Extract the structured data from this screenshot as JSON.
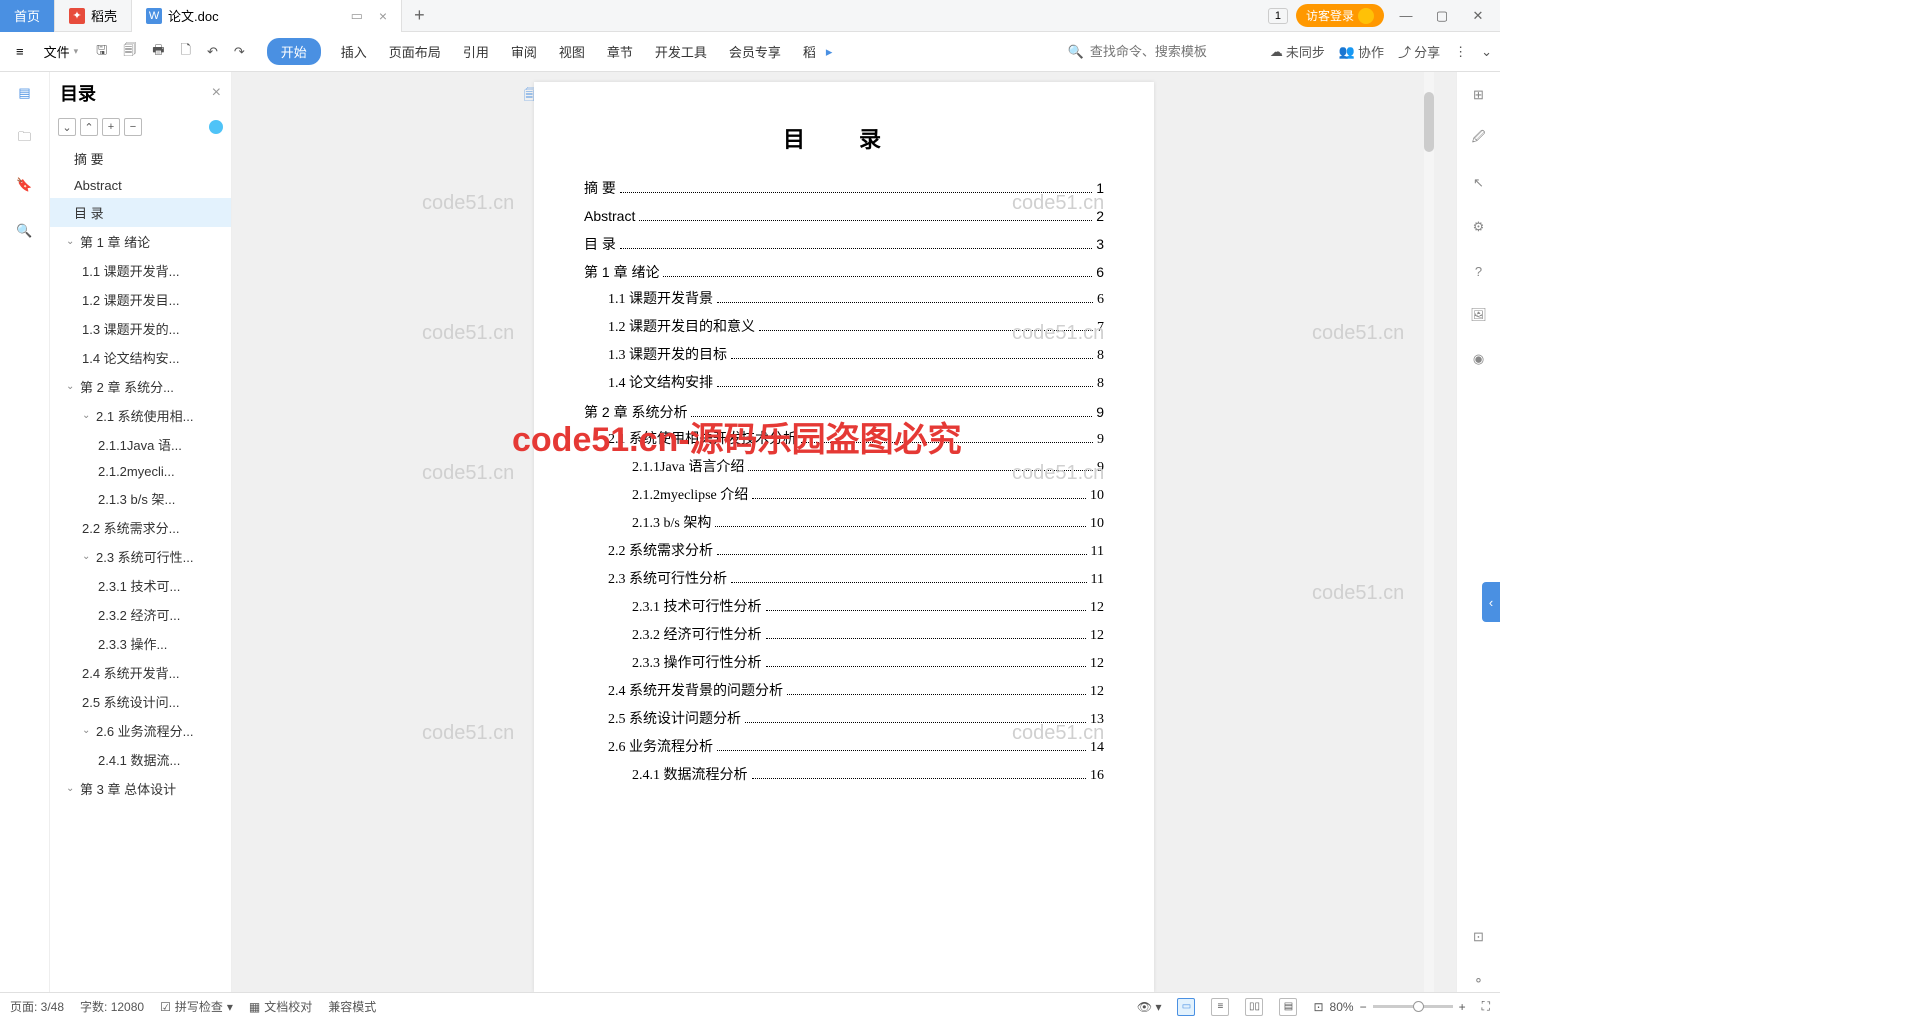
{
  "tabs": {
    "home": "首页",
    "doke": "稻壳",
    "doc": "论文.doc"
  },
  "titlebar": {
    "badge": "1",
    "login": "访客登录"
  },
  "ribbon": {
    "file": "文件",
    "tabs": [
      "开始",
      "插入",
      "页面布局",
      "引用",
      "审阅",
      "视图",
      "章节",
      "开发工具",
      "会员专享",
      "稻"
    ],
    "search_placeholder": "查找命令、搜索模板",
    "unsync": "未同步",
    "collab": "协作",
    "share": "分享"
  },
  "outline": {
    "title": "目录",
    "items": [
      {
        "label": "摘  要",
        "level": 0
      },
      {
        "label": "Abstract",
        "level": 0
      },
      {
        "label": "目  录",
        "level": 0,
        "selected": true
      },
      {
        "label": "第 1 章  绪论",
        "level": 1,
        "chev": true
      },
      {
        "label": "1.1 课题开发背...",
        "level": 2
      },
      {
        "label": "1.2 课题开发目...",
        "level": 2
      },
      {
        "label": "1.3 课题开发的...",
        "level": 2
      },
      {
        "label": "1.4 论文结构安...",
        "level": 2
      },
      {
        "label": "第 2 章  系统分...",
        "level": 1,
        "chev": true
      },
      {
        "label": "2.1 系统使用相...",
        "level": 2,
        "chev": true
      },
      {
        "label": "2.1.1Java 语...",
        "level": 3
      },
      {
        "label": "2.1.2myecli...",
        "level": 3
      },
      {
        "label": "2.1.3 b/s 架...",
        "level": 3
      },
      {
        "label": "2.2 系统需求分...",
        "level": 2
      },
      {
        "label": "2.3 系统可行性...",
        "level": 2,
        "chev": true
      },
      {
        "label": "2.3.1 技术可...",
        "level": 3
      },
      {
        "label": "2.3.2 经济可...",
        "level": 3
      },
      {
        "label": "2.3.3  操作...",
        "level": 3
      },
      {
        "label": "2.4 系统开发背...",
        "level": 2
      },
      {
        "label": "2.5 系统设计问...",
        "level": 2
      },
      {
        "label": "2.6 业务流程分...",
        "level": 2,
        "chev": true
      },
      {
        "label": "2.4.1 数据流...",
        "level": 3
      },
      {
        "label": "第 3 章 总体设计",
        "level": 1,
        "chev": true
      }
    ]
  },
  "document": {
    "title": "目  录",
    "toc": [
      {
        "text": "摘  要",
        "page": "1",
        "lv": 0
      },
      {
        "text": "Abstract",
        "page": "2",
        "lv": 0
      },
      {
        "text": "目  录",
        "page": "3",
        "lv": 0
      },
      {
        "text": "第 1 章  绪论",
        "page": "6",
        "lv": 0
      },
      {
        "text": "1.1 课题开发背景",
        "page": "6",
        "lv": 1
      },
      {
        "text": "1.2 课题开发目的和意义",
        "page": "7",
        "lv": 1
      },
      {
        "text": "1.3 课题开发的目标",
        "page": "8",
        "lv": 1
      },
      {
        "text": "1.4 论文结构安排",
        "page": "8",
        "lv": 1
      },
      {
        "text": "第 2 章  系统分析",
        "page": "9",
        "lv": 0
      },
      {
        "text": "2.1 系统使用相关开发技术分析",
        "page": "9",
        "lv": 1
      },
      {
        "text": "2.1.1Java 语言介绍",
        "page": "9",
        "lv": 2
      },
      {
        "text": "2.1.2myeclipse 介绍",
        "page": "10",
        "lv": 2
      },
      {
        "text": "2.1.3 b/s 架构",
        "page": "10",
        "lv": 2
      },
      {
        "text": "2.2 系统需求分析",
        "page": "11",
        "lv": 1
      },
      {
        "text": "2.3 系统可行性分析",
        "page": "11",
        "lv": 1
      },
      {
        "text": "2.3.1 技术可行性分析",
        "page": "12",
        "lv": 2
      },
      {
        "text": "2.3.2 经济可行性分析",
        "page": "12",
        "lv": 2
      },
      {
        "text": "2.3.3 操作可行性分析",
        "page": "12",
        "lv": 2
      },
      {
        "text": "2.4 系统开发背景的问题分析",
        "page": "12",
        "lv": 1
      },
      {
        "text": "2.5 系统设计问题分析",
        "page": "13",
        "lv": 1
      },
      {
        "text": "2.6 业务流程分析",
        "page": "14",
        "lv": 1
      },
      {
        "text": "2.4.1 数据流程分析",
        "page": "16",
        "lv": 2
      }
    ]
  },
  "watermarks": {
    "wm": "code51.cn",
    "red": "code51.cn-源码乐园盗图必究"
  },
  "status": {
    "page": "页面: 3/48",
    "words": "字数: 12080",
    "spell": "拼写检查",
    "proof": "文档校对",
    "compat": "兼容模式",
    "zoom": "80%"
  }
}
